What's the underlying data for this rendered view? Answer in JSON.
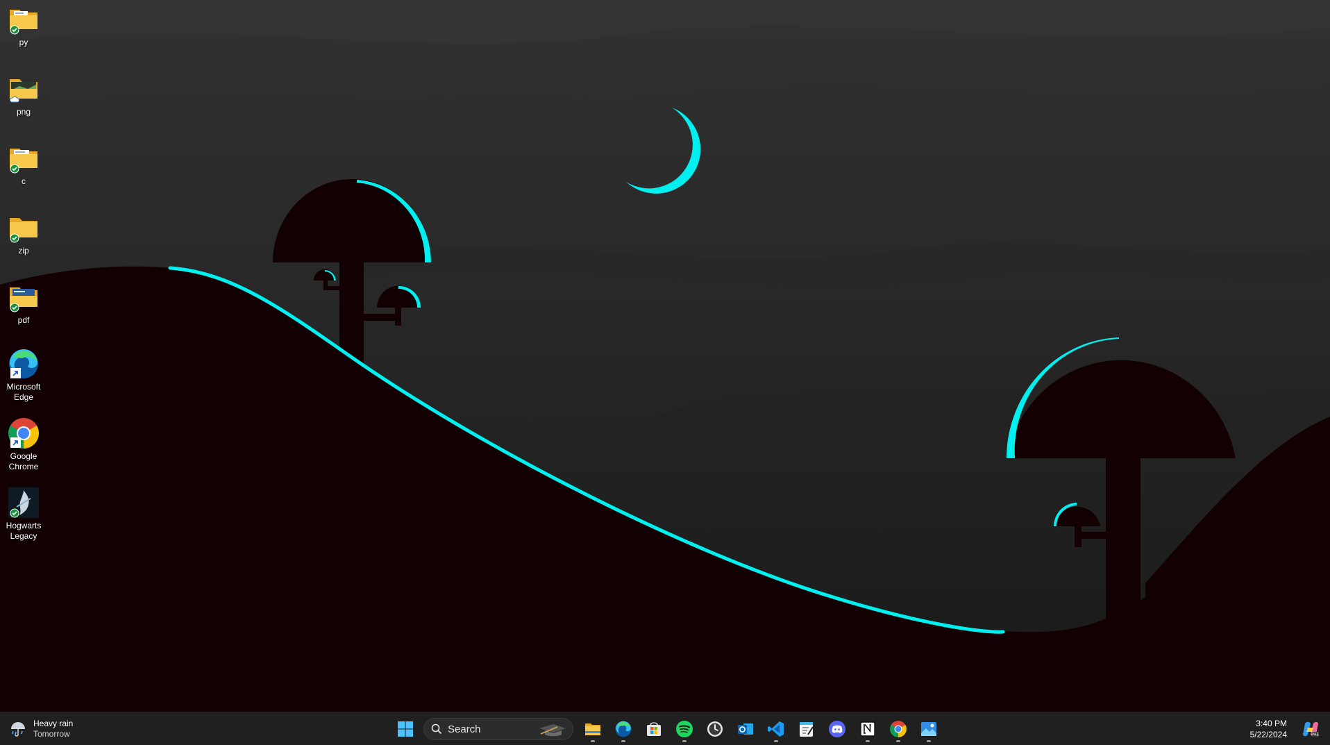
{
  "desktop": {
    "icons": [
      {
        "label": "py",
        "type": "folder"
      },
      {
        "label": "png",
        "type": "folder"
      },
      {
        "label": "c",
        "type": "folder"
      },
      {
        "label": "zip",
        "type": "folder"
      },
      {
        "label": "pdf",
        "type": "folder"
      },
      {
        "label": "Microsoft Edge",
        "type": "shortcut"
      },
      {
        "label": "Google Chrome",
        "type": "shortcut"
      },
      {
        "label": "Hogwarts Legacy",
        "type": "shortcut"
      }
    ]
  },
  "taskbar": {
    "weather": {
      "title": "Heavy rain",
      "subtitle": "Tomorrow",
      "icon": "umbrella-rain-icon"
    },
    "search": {
      "label": "Search",
      "icon": "search-icon"
    },
    "apps": [
      {
        "name": "start",
        "icon": "windows-logo-icon",
        "running": false
      },
      {
        "name": "file-explorer",
        "icon": "folder-icon",
        "running": true
      },
      {
        "name": "microsoft-edge",
        "icon": "edge-icon",
        "running": true
      },
      {
        "name": "microsoft-store",
        "icon": "store-icon",
        "running": false
      },
      {
        "name": "spotify",
        "icon": "spotify-icon",
        "running": true
      },
      {
        "name": "clock-app",
        "icon": "clock-icon",
        "running": false
      },
      {
        "name": "outlook",
        "icon": "outlook-icon",
        "running": false
      },
      {
        "name": "vs-code",
        "icon": "vscode-icon",
        "running": true
      },
      {
        "name": "notepad",
        "icon": "notepad-icon",
        "running": false
      },
      {
        "name": "discord",
        "icon": "discord-icon",
        "running": false
      },
      {
        "name": "notion",
        "icon": "notion-icon",
        "running": true
      },
      {
        "name": "google-chrome",
        "icon": "chrome-icon",
        "running": true
      },
      {
        "name": "photos",
        "icon": "photos-icon",
        "running": true
      }
    ],
    "clock": {
      "time": "3:40 PM",
      "date": "5/22/2024"
    }
  },
  "colors": {
    "accent_cyan": "#00f0f0",
    "silhouette": "#120003",
    "sky_dark": "#1a1a1a",
    "taskbar_bg": "#202020",
    "folder_yellow": "#f4c242"
  }
}
